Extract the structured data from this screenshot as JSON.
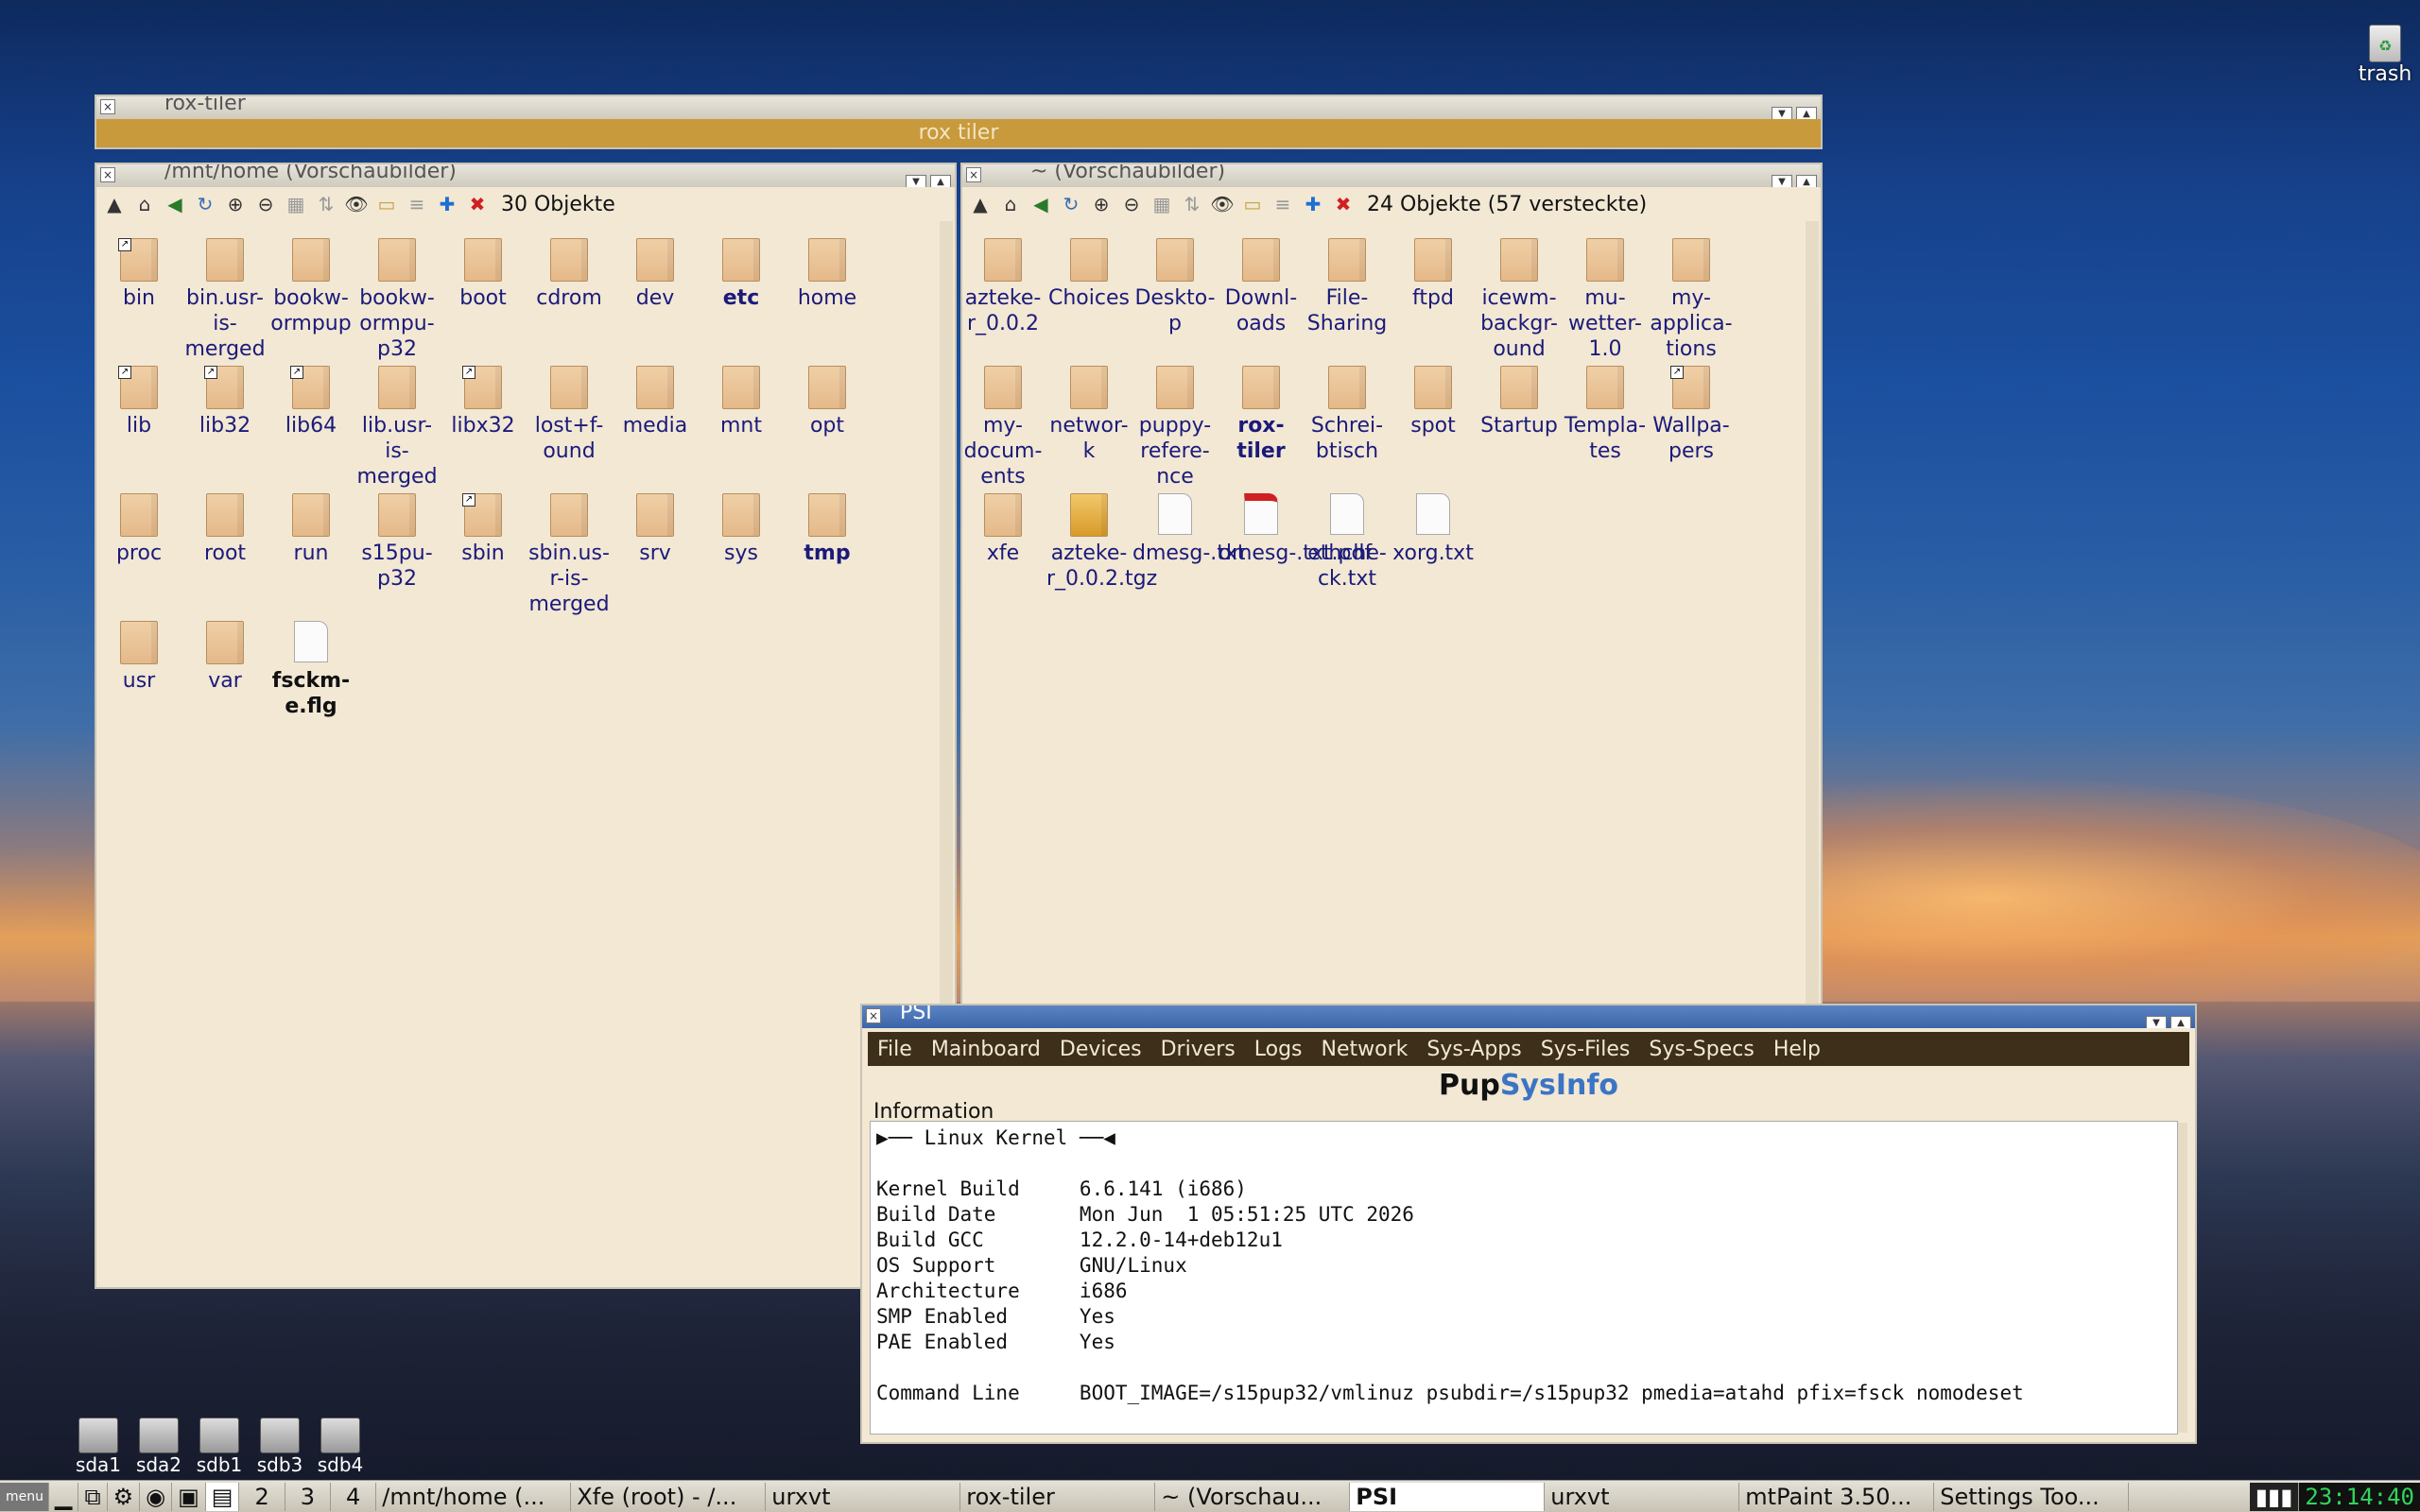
{
  "desktop": {
    "trash_label": "trash",
    "drives": [
      "sda1",
      "sda2",
      "sdb1",
      "sdb3",
      "sdb4"
    ]
  },
  "roxtiler": {
    "title": "rox-tiler",
    "banner": "rox tiler"
  },
  "left_pane": {
    "title": "/mnt/home (Vorschaubilder)",
    "count": "30 Objekte",
    "items": [
      {
        "label": "bin",
        "type": "folder",
        "link": true
      },
      {
        "label": "bin.usr-is-merged",
        "type": "folder"
      },
      {
        "label": "bookw-ormpup",
        "type": "folder"
      },
      {
        "label": "bookw-ormpu-p32",
        "type": "folder"
      },
      {
        "label": "boot",
        "type": "folder"
      },
      {
        "label": "cdrom",
        "type": "folder"
      },
      {
        "label": "dev",
        "type": "folder"
      },
      {
        "label": "etc",
        "type": "folder",
        "bold": true
      },
      {
        "label": "home",
        "type": "folder"
      },
      {
        "label": "lib",
        "type": "folder",
        "link": true
      },
      {
        "label": "lib32",
        "type": "folder",
        "link": true
      },
      {
        "label": "lib64",
        "type": "folder",
        "link": true
      },
      {
        "label": "lib.usr-is-merged",
        "type": "folder"
      },
      {
        "label": "libx32",
        "type": "folder",
        "link": true
      },
      {
        "label": "lost+f-ound",
        "type": "folder"
      },
      {
        "label": "media",
        "type": "folder"
      },
      {
        "label": "mnt",
        "type": "folder"
      },
      {
        "label": "opt",
        "type": "folder"
      },
      {
        "label": "proc",
        "type": "folder"
      },
      {
        "label": "root",
        "type": "folder"
      },
      {
        "label": "run",
        "type": "folder"
      },
      {
        "label": "s15pu-p32",
        "type": "folder"
      },
      {
        "label": "sbin",
        "type": "folder",
        "link": true
      },
      {
        "label": "sbin.us-r-is-merged",
        "type": "folder"
      },
      {
        "label": "srv",
        "type": "folder"
      },
      {
        "label": "sys",
        "type": "folder"
      },
      {
        "label": "tmp",
        "type": "folder",
        "bold": true
      },
      {
        "label": "usr",
        "type": "folder"
      },
      {
        "label": "var",
        "type": "folder"
      },
      {
        "label": "fsckm-e.flg",
        "type": "doc",
        "bold": true,
        "black": true
      }
    ]
  },
  "right_pane": {
    "title": "~ (Vorschaubilder)",
    "count": "24 Objekte (57 versteckte)",
    "items": [
      {
        "label": "azteke-r_0.0.2",
        "type": "folder"
      },
      {
        "label": "Choices",
        "type": "folder"
      },
      {
        "label": "Deskto-p",
        "type": "folder"
      },
      {
        "label": "Downl-oads",
        "type": "folder"
      },
      {
        "label": "File-Sharing",
        "type": "folder"
      },
      {
        "label": "ftpd",
        "type": "folder"
      },
      {
        "label": "icewm-backgr-ound",
        "type": "folder"
      },
      {
        "label": "mu-wetter-1.0",
        "type": "folder"
      },
      {
        "label": "my-applica-tions",
        "type": "folder"
      },
      {
        "label": "my-docum-ents",
        "type": "folder"
      },
      {
        "label": "networ-k",
        "type": "folder"
      },
      {
        "label": "puppy-refere-nce",
        "type": "folder"
      },
      {
        "label": "rox-tiler",
        "type": "folder",
        "bold": true
      },
      {
        "label": "Schrei-btisch",
        "type": "folder"
      },
      {
        "label": "spot",
        "type": "folder"
      },
      {
        "label": "Startup",
        "type": "folder"
      },
      {
        "label": "Templa-tes",
        "type": "folder"
      },
      {
        "label": "Wallpa-pers",
        "type": "folder",
        "link": true
      },
      {
        "label": "xfe",
        "type": "folder"
      },
      {
        "label": "azteke-r_0.0.2.tgz",
        "type": "pkg"
      },
      {
        "label": "dmesg-.txt",
        "type": "doc"
      },
      {
        "label": "dmesg-.txt.pdf",
        "type": "pdf"
      },
      {
        "label": "ethche-ck.txt",
        "type": "doc"
      },
      {
        "label": "xorg.txt",
        "type": "doc"
      }
    ]
  },
  "psi": {
    "title": "PSI",
    "menu": [
      "File",
      "Mainboard",
      "Devices",
      "Drivers",
      "Logs",
      "Network",
      "Sys-Apps",
      "Sys-Files",
      "Sys-Specs",
      "Help"
    ],
    "brand_a": "Pup",
    "brand_b": "SysInfo",
    "section": "Information",
    "lines": [
      "▶── Linux Kernel ──◀",
      "",
      "Kernel Build     6.6.141 (i686)",
      "Build Date       Mon Jun  1 05:51:25 UTC 2026",
      "Build GCC        12.2.0-14+deb12u1",
      "OS Support       GNU/Linux",
      "Architecture     i686",
      "SMP Enabled      Yes",
      "PAE Enabled      Yes",
      "",
      "Command Line     BOOT_IMAGE=/s15pup32/vmlinuz psubdir=/s15pup32 pmedia=atahd pfix=fsck nomodeset"
    ]
  },
  "taskbar": {
    "desks": [
      "2",
      "3",
      "4"
    ],
    "tasks": [
      "/mnt/home (...",
      "Xfe (root) - /...",
      "urxvt",
      "rox-tiler",
      "~ (Vorschau...",
      "PSI",
      "urxvt",
      "mtPaint 3.50...",
      "Settings Too..."
    ],
    "clock": "23:14:40"
  }
}
